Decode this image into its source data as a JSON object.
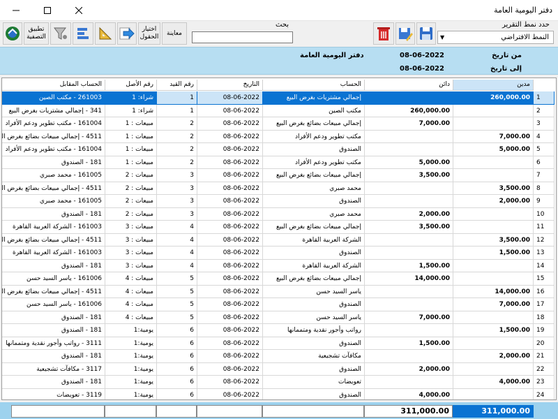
{
  "window": {
    "title": "دفتر اليومية العامة"
  },
  "toolbar": {
    "apply_filter": "تطبيق التصفية",
    "choose_fields": "اختيار الحقول",
    "preview": "معاينة",
    "search_label": "بحث",
    "search_value": "",
    "report_type_label": "حدد نمط التقرير",
    "report_type_value": "النمط الافتراضي"
  },
  "band": {
    "title": "دفتر اليومية العامة",
    "from_label": "من تاريخ",
    "from_date": "08-06-2022",
    "to_label": "إلى تاريخ",
    "to_date": "08-06-2022"
  },
  "table": {
    "columns": {
      "debit": "مدين",
      "credit": "دائن",
      "account": "الحساب",
      "date": "التاريخ",
      "entry_no": "رقم القيد",
      "origin_no": "رقم الأصل",
      "counter_account": "الحساب المقابل"
    },
    "rows": [
      {
        "n": "1",
        "debit": "260,000.00",
        "credit": "",
        "account": "إجمالي مشتريات بغرض البيع",
        "date": "08-06-2022",
        "entry": "1",
        "origin": "شراء: 1",
        "counter": "261003 - مكتب الصين"
      },
      {
        "n": "2",
        "debit": "",
        "credit": "260,000.00",
        "account": "مكتب الصين",
        "date": "08-06-2022",
        "entry": "1",
        "origin": "شراء: 1",
        "counter": "341 - إجمالي مشتريات بغرض البيع"
      },
      {
        "n": "3",
        "debit": "",
        "credit": "7,000.00",
        "account": "إجمالي مبيعات بضائع بغرض البيع",
        "date": "08-06-2022",
        "entry": "2",
        "origin": "مبيعات : 1",
        "counter": "161004 - مكتب تطوير ودعم الأفراد"
      },
      {
        "n": "4",
        "debit": "7,000.00",
        "credit": "",
        "account": "مكتب تطوير ودعم الأفراد",
        "date": "08-06-2022",
        "entry": "2",
        "origin": "مبيعات : 1",
        "counter": "4511 - إجمالي مبيعات بضائع بغرض البيع"
      },
      {
        "n": "5",
        "debit": "5,000.00",
        "credit": "",
        "account": "الصندوق",
        "date": "08-06-2022",
        "entry": "2",
        "origin": "مبيعات : 1",
        "counter": "161004 - مكتب تطوير ودعم الأفراد"
      },
      {
        "n": "6",
        "debit": "",
        "credit": "5,000.00",
        "account": "مكتب تطوير ودعم الأفراد",
        "date": "08-06-2022",
        "entry": "2",
        "origin": "مبيعات : 1",
        "counter": "181 - الصندوق"
      },
      {
        "n": "7",
        "debit": "",
        "credit": "3,500.00",
        "account": "إجمالي مبيعات بضائع بغرض البيع",
        "date": "08-06-2022",
        "entry": "3",
        "origin": "مبيعات : 2",
        "counter": "161005 - محمد صبري"
      },
      {
        "n": "8",
        "debit": "3,500.00",
        "credit": "",
        "account": "محمد صبري",
        "date": "08-06-2022",
        "entry": "3",
        "origin": "مبيعات : 2",
        "counter": "4511 - إجمالي مبيعات بضائع بغرض البيع"
      },
      {
        "n": "9",
        "debit": "2,000.00",
        "credit": "",
        "account": "الصندوق",
        "date": "08-06-2022",
        "entry": "3",
        "origin": "مبيعات : 2",
        "counter": "161005 - محمد صبري"
      },
      {
        "n": "10",
        "debit": "",
        "credit": "2,000.00",
        "account": "محمد صبري",
        "date": "08-06-2022",
        "entry": "3",
        "origin": "مبيعات : 2",
        "counter": "181 - الصندوق"
      },
      {
        "n": "11",
        "debit": "",
        "credit": "3,500.00",
        "account": "إجمالي مبيعات بضائع بغرض البيع",
        "date": "08-06-2022",
        "entry": "4",
        "origin": "مبيعات : 3",
        "counter": "161003 - الشركة العربية القاهرة"
      },
      {
        "n": "12",
        "debit": "3,500.00",
        "credit": "",
        "account": "الشركة العربية القاهرة",
        "date": "08-06-2022",
        "entry": "4",
        "origin": "مبيعات : 3",
        "counter": "4511 - إجمالي مبيعات بضائع بغرض البيع"
      },
      {
        "n": "13",
        "debit": "1,500.00",
        "credit": "",
        "account": "الصندوق",
        "date": "08-06-2022",
        "entry": "4",
        "origin": "مبيعات : 3",
        "counter": "161003 - الشركة العربية القاهرة"
      },
      {
        "n": "14",
        "debit": "",
        "credit": "1,500.00",
        "account": "الشركة العربية القاهرة",
        "date": "08-06-2022",
        "entry": "4",
        "origin": "مبيعات : 3",
        "counter": "181 - الصندوق"
      },
      {
        "n": "15",
        "debit": "",
        "credit": "14,000.00",
        "account": "إجمالي مبيعات بضائع بغرض البيع",
        "date": "08-06-2022",
        "entry": "5",
        "origin": "مبيعات : 4",
        "counter": "161006 - ياسر السيد حسن"
      },
      {
        "n": "16",
        "debit": "14,000.00",
        "credit": "",
        "account": "ياسر السيد حسن",
        "date": "08-06-2022",
        "entry": "5",
        "origin": "مبيعات : 4",
        "counter": "4511 - إجمالي مبيعات بضائع بغرض البيع"
      },
      {
        "n": "17",
        "debit": "7,000.00",
        "credit": "",
        "account": "الصندوق",
        "date": "08-06-2022",
        "entry": "5",
        "origin": "مبيعات : 4",
        "counter": "161006 - ياسر السيد حسن"
      },
      {
        "n": "18",
        "debit": "",
        "credit": "7,000.00",
        "account": "ياسر السيد حسن",
        "date": "08-06-2022",
        "entry": "5",
        "origin": "مبيعات : 4",
        "counter": "181 - الصندوق"
      },
      {
        "n": "19",
        "debit": "1,500.00",
        "credit": "",
        "account": "رواتب وأجور نقدية ومتممانها",
        "date": "08-06-2022",
        "entry": "6",
        "origin": "يومية:1",
        "counter": "181 - الصندوق"
      },
      {
        "n": "20",
        "debit": "",
        "credit": "1,500.00",
        "account": "الصندوق",
        "date": "08-06-2022",
        "entry": "6",
        "origin": "يومية:1",
        "counter": "3111 - رواتب وأجور نقدية ومتممانها"
      },
      {
        "n": "21",
        "debit": "2,000.00",
        "credit": "",
        "account": "مكافآت تشجيعية",
        "date": "08-06-2022",
        "entry": "6",
        "origin": "يومية:1",
        "counter": "181 - الصندوق"
      },
      {
        "n": "22",
        "debit": "",
        "credit": "2,000.00",
        "account": "الصندوق",
        "date": "08-06-2022",
        "entry": "6",
        "origin": "يومية:1",
        "counter": "3117 - مكافآت تشجيعية"
      },
      {
        "n": "23",
        "debit": "4,000.00",
        "credit": "",
        "account": "تعويضات",
        "date": "08-06-2022",
        "entry": "6",
        "origin": "يومية:1",
        "counter": "181 - الصندوق"
      },
      {
        "n": "24",
        "debit": "",
        "credit": "4,000.00",
        "account": "الصندوق",
        "date": "08-06-2022",
        "entry": "6",
        "origin": "يومية:1",
        "counter": "3119 - تعويضات"
      }
    ]
  },
  "footer": {
    "total_debit": "311,000.00",
    "total_credit": "311,000.00"
  },
  "colors": {
    "selection": "#0a73d2",
    "band": "#b7def2",
    "footer": "#9dd2ee"
  }
}
